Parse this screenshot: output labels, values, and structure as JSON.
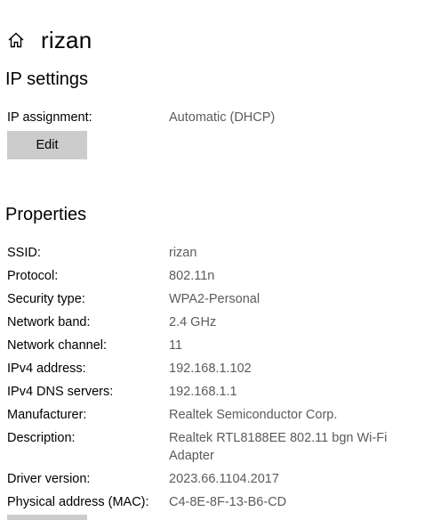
{
  "header": {
    "home_icon": "home-icon",
    "title": "rizan"
  },
  "ip_settings": {
    "title": "IP settings",
    "assignment_label": "IP assignment:",
    "assignment_value": "Automatic (DHCP)",
    "edit_label": "Edit"
  },
  "properties": {
    "title": "Properties",
    "rows": [
      {
        "label": "SSID:",
        "value": "rizan"
      },
      {
        "label": "Protocol:",
        "value": "802.11n"
      },
      {
        "label": "Security type:",
        "value": "WPA2-Personal"
      },
      {
        "label": "Network band:",
        "value": "2.4 GHz"
      },
      {
        "label": "Network channel:",
        "value": "11"
      },
      {
        "label": "IPv4 address:",
        "value": "192.168.1.102"
      },
      {
        "label": "IPv4 DNS servers:",
        "value": "192.168.1.1"
      },
      {
        "label": "Manufacturer:",
        "value": "Realtek Semiconductor Corp."
      },
      {
        "label": "Description:",
        "value": "Realtek RTL8188EE 802.11 bgn Wi-Fi Adapter"
      },
      {
        "label": "Driver version:",
        "value": "2023.66.1104.2017"
      },
      {
        "label": "Physical address (MAC):",
        "value": "C4-8E-8F-13-B6-CD"
      }
    ]
  }
}
